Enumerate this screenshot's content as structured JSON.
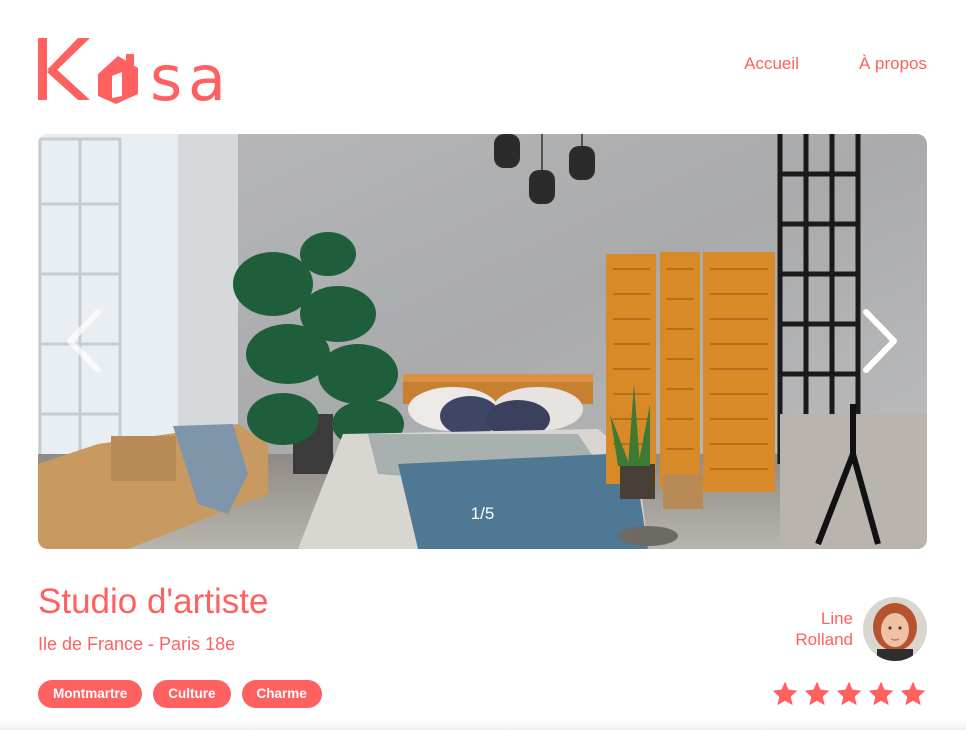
{
  "brand": {
    "logo_text": "Kasa",
    "accent_color": "#FF6060"
  },
  "nav": {
    "items": [
      {
        "label": "Accueil"
      },
      {
        "label": "À propos"
      }
    ]
  },
  "gallery": {
    "counter": "1/5",
    "current": 1,
    "total": 5,
    "prev_icon": "chevron-left-icon",
    "next_icon": "chevron-right-icon"
  },
  "listing": {
    "title": "Studio d'artiste",
    "location": "Ile de France - Paris 18e",
    "tags": [
      "Montmartre",
      "Culture",
      "Charme"
    ],
    "rating": 5,
    "rating_max": 5,
    "star_color_active": "#FF6060",
    "star_color_inactive": "#E3E3E3"
  },
  "host": {
    "first_name": "Line",
    "last_name": "Rolland"
  }
}
